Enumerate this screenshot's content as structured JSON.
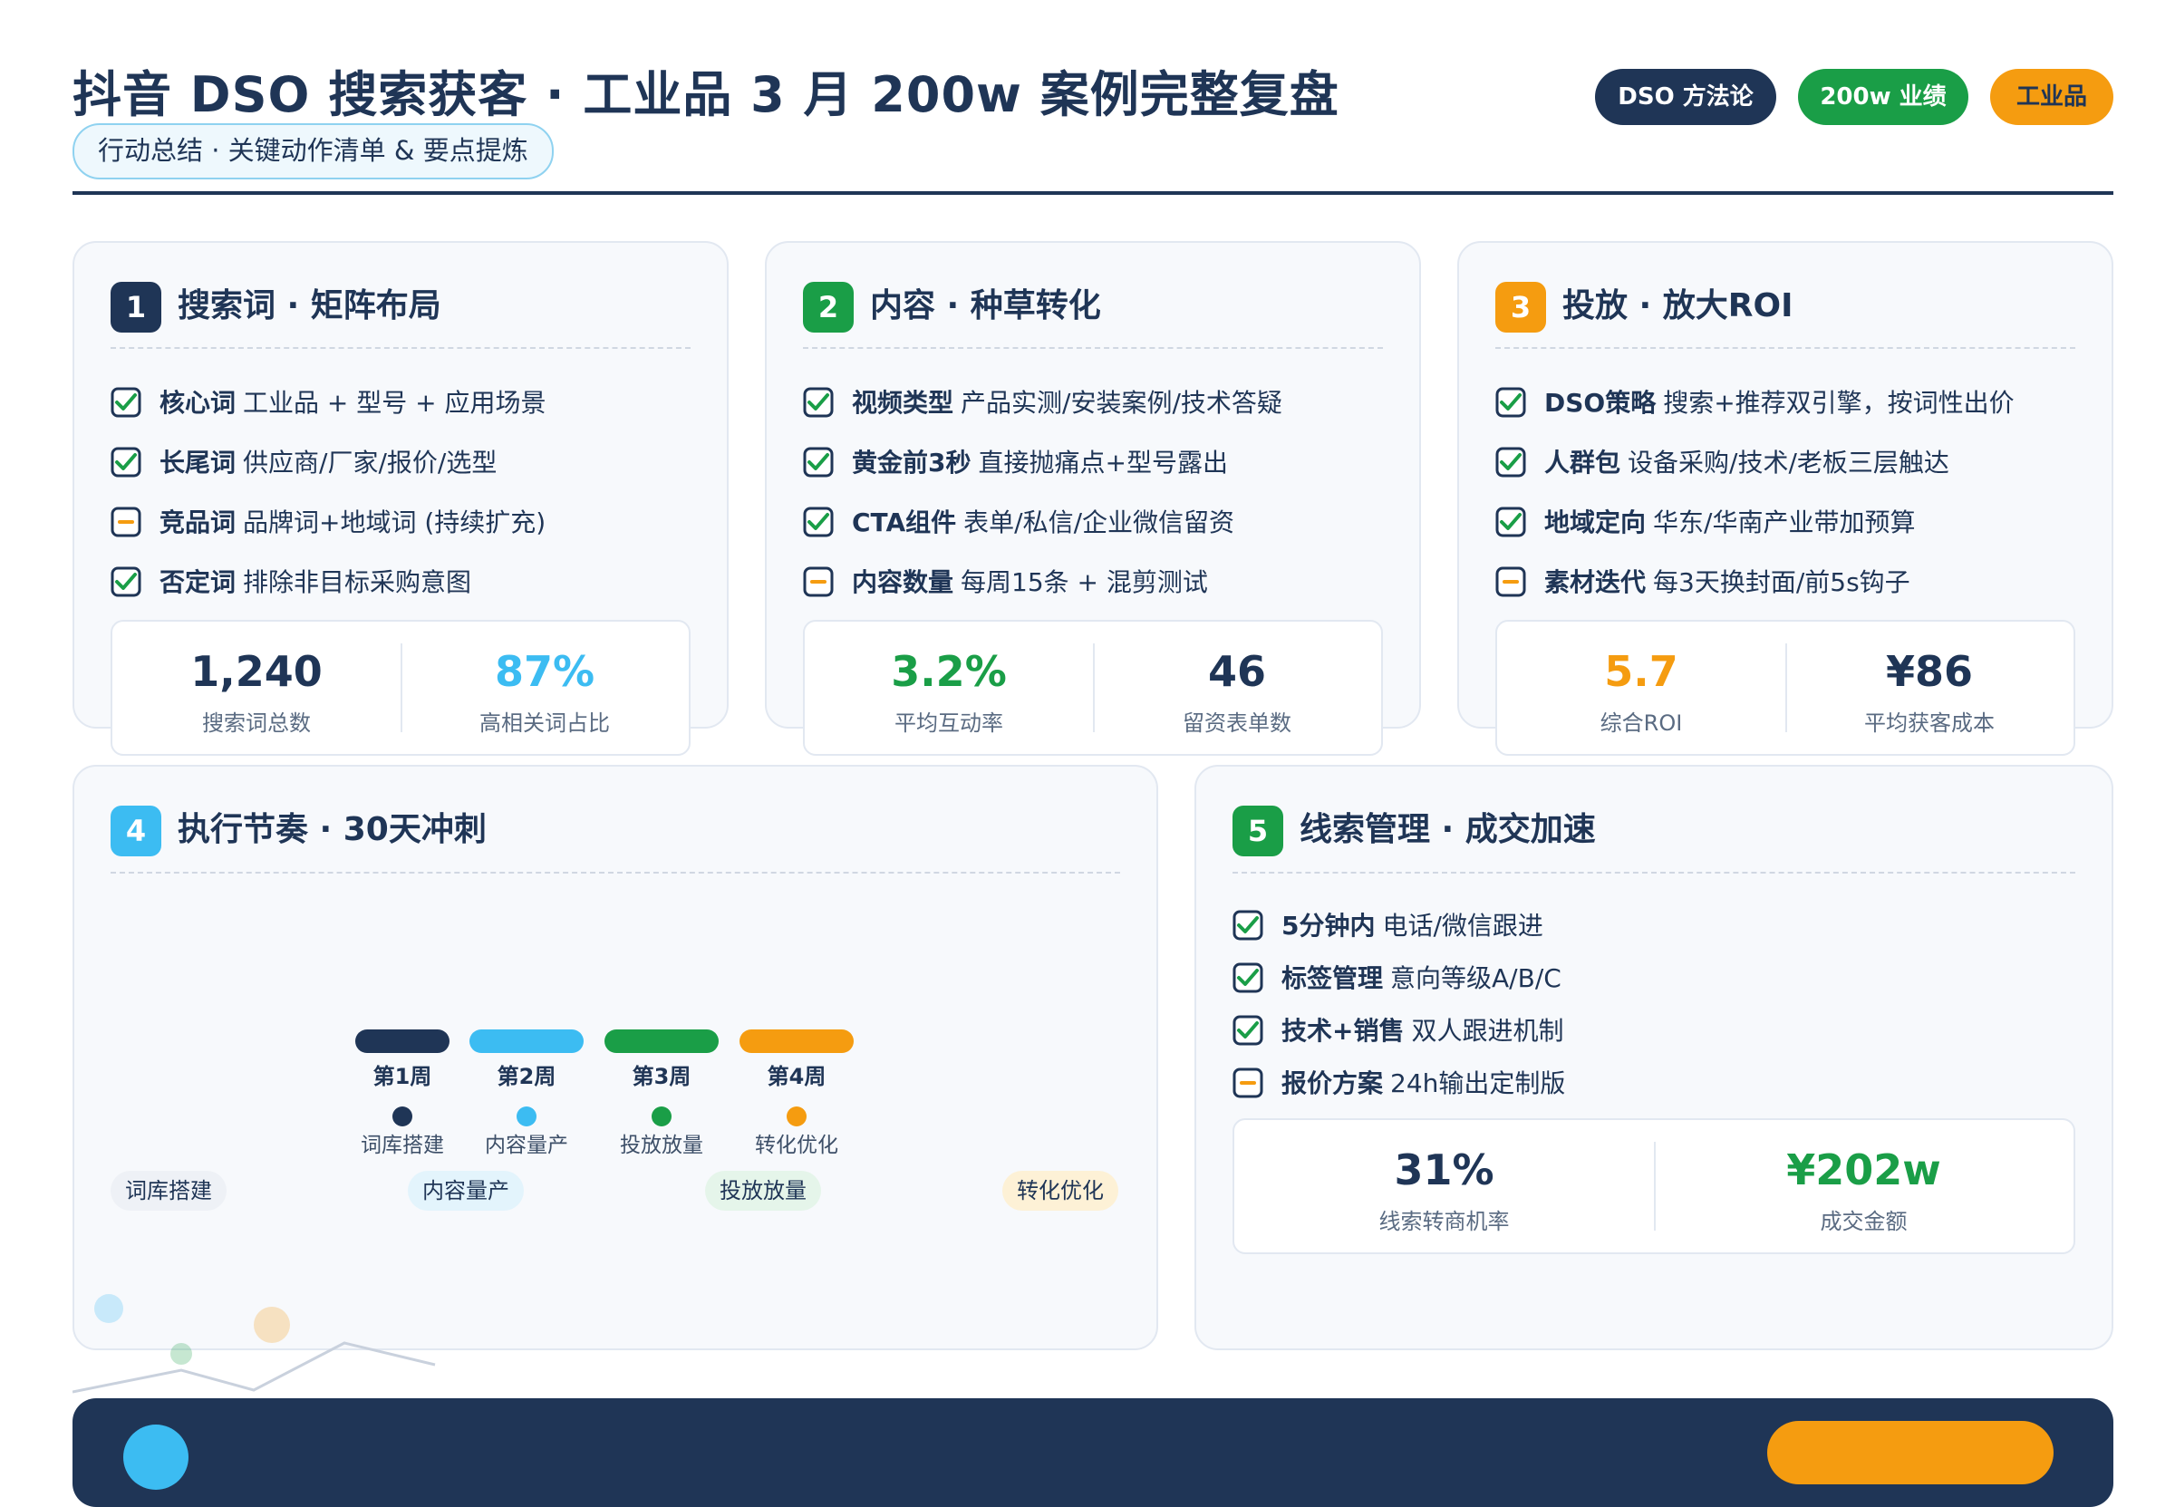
{
  "header": {
    "title": "抖音 DSO 搜索获客 · 工业品 3 月 200w 案例完整复盘",
    "subtitle": "行动总结 · 关键动作清单 & 要点提炼",
    "pills": [
      "DSO 方法论",
      "200w 业绩",
      "工业品"
    ]
  },
  "colors": {
    "navy": "#1f3556",
    "green": "#1a9e47",
    "orange": "#f59c10",
    "sky": "#3cbcf2"
  },
  "cards": [
    {
      "num": "1",
      "title": "搜索词 · 矩阵布局",
      "items": [
        {
          "status": "checked",
          "key": "核心词",
          "text": "工业品 + 型号 + 应用场景"
        },
        {
          "status": "checked",
          "key": "长尾词",
          "text": "供应商/厂家/报价/选型"
        },
        {
          "status": "pending",
          "key": "竞品词",
          "text": "品牌词+地域词 (持续扩充)"
        },
        {
          "status": "checked",
          "key": "否定词",
          "text": "排除非目标采购意图"
        }
      ],
      "stats": [
        {
          "value": "1,240",
          "label": "搜索词总数"
        },
        {
          "value": "87%",
          "label": "高相关词占比"
        }
      ]
    },
    {
      "num": "2",
      "title": "内容 · 种草转化",
      "items": [
        {
          "status": "checked",
          "key": "视频类型",
          "text": "产品实测/安装案例/技术答疑"
        },
        {
          "status": "checked",
          "key": "黄金前3秒",
          "text": "直接抛痛点+型号露出"
        },
        {
          "status": "checked",
          "key": "CTA组件",
          "text": "表单/私信/企业微信留资"
        },
        {
          "status": "pending",
          "key": "内容数量",
          "text": "每周15条 + 混剪测试"
        }
      ],
      "stats": [
        {
          "value": "3.2%",
          "label": "平均互动率"
        },
        {
          "value": "46",
          "label": "留资表单数"
        }
      ]
    },
    {
      "num": "3",
      "title": "投放 · 放大ROI",
      "items": [
        {
          "status": "checked",
          "key": "DSO策略",
          "text": "搜索+推荐双引擎，按词性出价"
        },
        {
          "status": "checked",
          "key": "人群包",
          "text": "设备采购/技术/老板三层触达"
        },
        {
          "status": "checked",
          "key": "地域定向",
          "text": "华东/华南产业带加预算"
        },
        {
          "status": "pending",
          "key": "素材迭代",
          "text": "每3天换封面/前5s钩子"
        }
      ],
      "stats": [
        {
          "value": "5.7",
          "label": "综合ROI"
        },
        {
          "value": "¥86",
          "label": "平均获客成本"
        }
      ]
    },
    {
      "num": "4",
      "title": "执行节奏 · 30天冲刺",
      "weeks": [
        {
          "label": "第1周",
          "task": "词库搭建"
        },
        {
          "label": "第2周",
          "task": "内容量产"
        },
        {
          "label": "第3周",
          "task": "投放放量"
        },
        {
          "label": "第4周",
          "task": "转化优化"
        }
      ],
      "chips": [
        "词库搭建",
        "内容量产",
        "投放放量",
        "转化优化"
      ]
    },
    {
      "num": "5",
      "title": "线索管理 · 成交加速",
      "items": [
        {
          "status": "checked",
          "key": "5分钟内",
          "text": "电话/微信跟进"
        },
        {
          "status": "checked",
          "key": "标签管理",
          "text": "意向等级A/B/C"
        },
        {
          "status": "checked",
          "key": "技术+销售",
          "text": "双人跟进机制"
        },
        {
          "status": "pending",
          "key": "报价方案",
          "text": "24h输出定制版"
        }
      ],
      "stats": [
        {
          "value": "31%",
          "label": "线索转商机率"
        },
        {
          "value": "¥202w",
          "label": "成交金额"
        }
      ]
    }
  ]
}
